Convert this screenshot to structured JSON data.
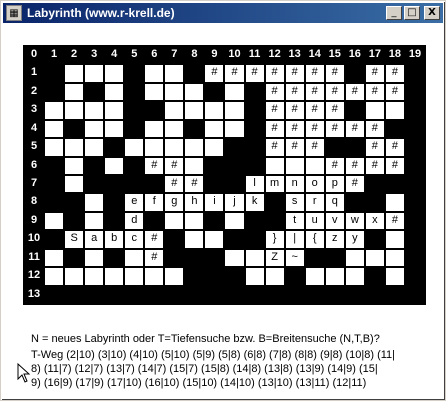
{
  "window": {
    "title": "Labyrinth (www.r-krell.de)",
    "icon": "maze-app-icon",
    "minimize": "_",
    "maximize": "□",
    "close": "X"
  },
  "grid": {
    "columns": [
      "0",
      "1",
      "2",
      "3",
      "4",
      "5",
      "6",
      "7",
      "8",
      "9",
      "10",
      "11",
      "12",
      "13",
      "14",
      "15",
      "16",
      "17",
      "18",
      "19"
    ],
    "rows": [
      [
        {
          "t": "b",
          "v": ""
        },
        {
          "t": "w",
          "v": ""
        },
        {
          "t": "w",
          "v": ""
        },
        {
          "t": "w",
          "v": ""
        },
        {
          "t": "b",
          "v": ""
        },
        {
          "t": "w",
          "v": ""
        },
        {
          "t": "w",
          "v": ""
        },
        {
          "t": "b",
          "v": ""
        },
        {
          "t": "w",
          "v": "#"
        },
        {
          "t": "w",
          "v": "#"
        },
        {
          "t": "w",
          "v": "#"
        },
        {
          "t": "w",
          "v": "#"
        },
        {
          "t": "w",
          "v": "#"
        },
        {
          "t": "w",
          "v": "#"
        },
        {
          "t": "w",
          "v": "#"
        },
        {
          "t": "b",
          "v": ""
        },
        {
          "t": "w",
          "v": "#"
        },
        {
          "t": "w",
          "v": "#"
        },
        {
          "t": "b",
          "v": ""
        }
      ],
      [
        {
          "t": "b",
          "v": ""
        },
        {
          "t": "w",
          "v": ""
        },
        {
          "t": "b",
          "v": ""
        },
        {
          "t": "w",
          "v": ""
        },
        {
          "t": "b",
          "v": ""
        },
        {
          "t": "w",
          "v": ""
        },
        {
          "t": "w",
          "v": ""
        },
        {
          "t": "w",
          "v": ""
        },
        {
          "t": "b",
          "v": ""
        },
        {
          "t": "w",
          "v": ""
        },
        {
          "t": "b",
          "v": ""
        },
        {
          "t": "w",
          "v": "#"
        },
        {
          "t": "w",
          "v": "#"
        },
        {
          "t": "w",
          "v": "#"
        },
        {
          "t": "w",
          "v": "#"
        },
        {
          "t": "w",
          "v": "#"
        },
        {
          "t": "w",
          "v": "#"
        },
        {
          "t": "w",
          "v": "#"
        },
        {
          "t": "b",
          "v": ""
        }
      ],
      [
        {
          "t": "w",
          "v": ""
        },
        {
          "t": "w",
          "v": ""
        },
        {
          "t": "w",
          "v": ""
        },
        {
          "t": "w",
          "v": ""
        },
        {
          "t": "b",
          "v": ""
        },
        {
          "t": "b",
          "v": ""
        },
        {
          "t": "w",
          "v": ""
        },
        {
          "t": "w",
          "v": ""
        },
        {
          "t": "w",
          "v": ""
        },
        {
          "t": "w",
          "v": ""
        },
        {
          "t": "b",
          "v": ""
        },
        {
          "t": "w",
          "v": "#"
        },
        {
          "t": "w",
          "v": "#"
        },
        {
          "t": "w",
          "v": "#"
        },
        {
          "t": "w",
          "v": "#"
        },
        {
          "t": "b",
          "v": ""
        },
        {
          "t": "w",
          "v": ""
        },
        {
          "t": "w",
          "v": ""
        },
        {
          "t": "b",
          "v": ""
        }
      ],
      [
        {
          "t": "w",
          "v": ""
        },
        {
          "t": "b",
          "v": ""
        },
        {
          "t": "w",
          "v": ""
        },
        {
          "t": "w",
          "v": ""
        },
        {
          "t": "b",
          "v": ""
        },
        {
          "t": "w",
          "v": ""
        },
        {
          "t": "w",
          "v": ""
        },
        {
          "t": "b",
          "v": ""
        },
        {
          "t": "w",
          "v": ""
        },
        {
          "t": "w",
          "v": ""
        },
        {
          "t": "b",
          "v": ""
        },
        {
          "t": "w",
          "v": "#"
        },
        {
          "t": "w",
          "v": "#"
        },
        {
          "t": "w",
          "v": "#"
        },
        {
          "t": "w",
          "v": "#"
        },
        {
          "t": "w",
          "v": "#"
        },
        {
          "t": "w",
          "v": "#"
        },
        {
          "t": "b",
          "v": ""
        },
        {
          "t": "b",
          "v": ""
        }
      ],
      [
        {
          "t": "w",
          "v": ""
        },
        {
          "t": "w",
          "v": ""
        },
        {
          "t": "w",
          "v": ""
        },
        {
          "t": "b",
          "v": ""
        },
        {
          "t": "w",
          "v": ""
        },
        {
          "t": "w",
          "v": ""
        },
        {
          "t": "w",
          "v": ""
        },
        {
          "t": "w",
          "v": ""
        },
        {
          "t": "w",
          "v": ""
        },
        {
          "t": "b",
          "v": ""
        },
        {
          "t": "b",
          "v": ""
        },
        {
          "t": "w",
          "v": "#"
        },
        {
          "t": "w",
          "v": "#"
        },
        {
          "t": "w",
          "v": "#"
        },
        {
          "t": "b",
          "v": ""
        },
        {
          "t": "b",
          "v": ""
        },
        {
          "t": "w",
          "v": "#"
        },
        {
          "t": "w",
          "v": "#"
        },
        {
          "t": "b",
          "v": ""
        }
      ],
      [
        {
          "t": "b",
          "v": ""
        },
        {
          "t": "w",
          "v": ""
        },
        {
          "t": "b",
          "v": ""
        },
        {
          "t": "w",
          "v": ""
        },
        {
          "t": "b",
          "v": ""
        },
        {
          "t": "w",
          "v": "#"
        },
        {
          "t": "w",
          "v": "#"
        },
        {
          "t": "w",
          "v": ""
        },
        {
          "t": "b",
          "v": ""
        },
        {
          "t": "b",
          "v": ""
        },
        {
          "t": "b",
          "v": ""
        },
        {
          "t": "w",
          "v": ""
        },
        {
          "t": "w",
          "v": ""
        },
        {
          "t": "w",
          "v": ""
        },
        {
          "t": "w",
          "v": "#"
        },
        {
          "t": "w",
          "v": "#"
        },
        {
          "t": "w",
          "v": "#"
        },
        {
          "t": "w",
          "v": "#"
        },
        {
          "t": "b",
          "v": ""
        }
      ],
      [
        {
          "t": "b",
          "v": ""
        },
        {
          "t": "w",
          "v": ""
        },
        {
          "t": "b",
          "v": ""
        },
        {
          "t": "b",
          "v": ""
        },
        {
          "t": "b",
          "v": ""
        },
        {
          "t": "b",
          "v": ""
        },
        {
          "t": "w",
          "v": "#"
        },
        {
          "t": "w",
          "v": "#"
        },
        {
          "t": "b",
          "v": ""
        },
        {
          "t": "b",
          "v": ""
        },
        {
          "t": "w",
          "v": "l"
        },
        {
          "t": "w",
          "v": "m"
        },
        {
          "t": "w",
          "v": "n"
        },
        {
          "t": "w",
          "v": "o"
        },
        {
          "t": "w",
          "v": "p"
        },
        {
          "t": "w",
          "v": "#"
        },
        {
          "t": "b",
          "v": ""
        },
        {
          "t": "b",
          "v": ""
        },
        {
          "t": "b",
          "v": ""
        }
      ],
      [
        {
          "t": "b",
          "v": ""
        },
        {
          "t": "b",
          "v": ""
        },
        {
          "t": "w",
          "v": ""
        },
        {
          "t": "b",
          "v": ""
        },
        {
          "t": "w",
          "v": "e"
        },
        {
          "t": "w",
          "v": "f"
        },
        {
          "t": "w",
          "v": "g"
        },
        {
          "t": "w",
          "v": "h"
        },
        {
          "t": "w",
          "v": "i"
        },
        {
          "t": "w",
          "v": "j"
        },
        {
          "t": "w",
          "v": "k"
        },
        {
          "t": "b",
          "v": ""
        },
        {
          "t": "w",
          "v": "s"
        },
        {
          "t": "w",
          "v": "r"
        },
        {
          "t": "w",
          "v": "q"
        },
        {
          "t": "b",
          "v": ""
        },
        {
          "t": "b",
          "v": ""
        },
        {
          "t": "w",
          "v": ""
        },
        {
          "t": "b",
          "v": ""
        }
      ],
      [
        {
          "t": "w",
          "v": ""
        },
        {
          "t": "b",
          "v": ""
        },
        {
          "t": "w",
          "v": ""
        },
        {
          "t": "b",
          "v": ""
        },
        {
          "t": "w",
          "v": "d"
        },
        {
          "t": "b",
          "v": ""
        },
        {
          "t": "w",
          "v": ""
        },
        {
          "t": "w",
          "v": ""
        },
        {
          "t": "b",
          "v": ""
        },
        {
          "t": "w",
          "v": ""
        },
        {
          "t": "b",
          "v": ""
        },
        {
          "t": "b",
          "v": ""
        },
        {
          "t": "w",
          "v": "t"
        },
        {
          "t": "w",
          "v": "u"
        },
        {
          "t": "w",
          "v": "v"
        },
        {
          "t": "w",
          "v": "w"
        },
        {
          "t": "w",
          "v": "x"
        },
        {
          "t": "w",
          "v": "#"
        },
        {
          "t": "b",
          "v": ""
        }
      ],
      [
        {
          "t": "b",
          "v": ""
        },
        {
          "t": "w",
          "v": "S"
        },
        {
          "t": "w",
          "v": "a"
        },
        {
          "t": "w",
          "v": "b"
        },
        {
          "t": "w",
          "v": "c"
        },
        {
          "t": "w",
          "v": "#"
        },
        {
          "t": "b",
          "v": ""
        },
        {
          "t": "w",
          "v": ""
        },
        {
          "t": "w",
          "v": ""
        },
        {
          "t": "b",
          "v": ""
        },
        {
          "t": "b",
          "v": ""
        },
        {
          "t": "w",
          "v": "}"
        },
        {
          "t": "w",
          "v": "|"
        },
        {
          "t": "w",
          "v": "{"
        },
        {
          "t": "w",
          "v": "z"
        },
        {
          "t": "w",
          "v": "y"
        },
        {
          "t": "b",
          "v": ""
        },
        {
          "t": "w",
          "v": ""
        },
        {
          "t": "b",
          "v": ""
        }
      ],
      [
        {
          "t": "w",
          "v": ""
        },
        {
          "t": "b",
          "v": ""
        },
        {
          "t": "w",
          "v": ""
        },
        {
          "t": "b",
          "v": ""
        },
        {
          "t": "w",
          "v": ""
        },
        {
          "t": "w",
          "v": "#"
        },
        {
          "t": "b",
          "v": ""
        },
        {
          "t": "b",
          "v": ""
        },
        {
          "t": "b",
          "v": ""
        },
        {
          "t": "w",
          "v": ""
        },
        {
          "t": "w",
          "v": ""
        },
        {
          "t": "w",
          "v": "Z"
        },
        {
          "t": "w",
          "v": "~"
        },
        {
          "t": "b",
          "v": ""
        },
        {
          "t": "b",
          "v": ""
        },
        {
          "t": "w",
          "v": ""
        },
        {
          "t": "w",
          "v": ""
        },
        {
          "t": "w",
          "v": ""
        },
        {
          "t": "b",
          "v": ""
        }
      ],
      [
        {
          "t": "w",
          "v": ""
        },
        {
          "t": "w",
          "v": ""
        },
        {
          "t": "w",
          "v": ""
        },
        {
          "t": "w",
          "v": ""
        },
        {
          "t": "w",
          "v": ""
        },
        {
          "t": "w",
          "v": ""
        },
        {
          "t": "w",
          "v": ""
        },
        {
          "t": "b",
          "v": ""
        },
        {
          "t": "b",
          "v": ""
        },
        {
          "t": "b",
          "v": ""
        },
        {
          "t": "w",
          "v": ""
        },
        {
          "t": "w",
          "v": ""
        },
        {
          "t": "b",
          "v": ""
        },
        {
          "t": "w",
          "v": ""
        },
        {
          "t": "w",
          "v": ""
        },
        {
          "t": "w",
          "v": ""
        },
        {
          "t": "b",
          "v": ""
        },
        {
          "t": "w",
          "v": ""
        },
        {
          "t": "b",
          "v": ""
        }
      ],
      [
        {
          "t": "b",
          "v": ""
        },
        {
          "t": "b",
          "v": ""
        },
        {
          "t": "b",
          "v": ""
        },
        {
          "t": "b",
          "v": ""
        },
        {
          "t": "b",
          "v": ""
        },
        {
          "t": "b",
          "v": ""
        },
        {
          "t": "b",
          "v": ""
        },
        {
          "t": "b",
          "v": ""
        },
        {
          "t": "b",
          "v": ""
        },
        {
          "t": "b",
          "v": ""
        },
        {
          "t": "b",
          "v": ""
        },
        {
          "t": "b",
          "v": ""
        },
        {
          "t": "b",
          "v": ""
        },
        {
          "t": "b",
          "v": ""
        },
        {
          "t": "b",
          "v": ""
        },
        {
          "t": "b",
          "v": ""
        },
        {
          "t": "b",
          "v": ""
        },
        {
          "t": "b",
          "v": ""
        },
        {
          "t": "b",
          "v": ""
        }
      ]
    ]
  },
  "status": {
    "prompt": "N = neues Labyrinth oder T=Tiefensuche bzw. B=Breitensuche (N,T,B)?"
  },
  "path": {
    "lines": [
      "T-Weg  (2|10) (3|10) (4|10) (5|10) (5|9) (5|8) (6|8) (7|8) (8|8) (9|8) (10|8) (11|",
      "8) (11|7) (12|7) (13|7) (14|7) (15|7) (15|8) (14|8) (13|8) (13|9) (14|9) (15|",
      "9) (16|9) (17|9) (17|10) (16|10) (15|10) (14|10) (13|10) (13|11) (12|11)"
    ]
  }
}
